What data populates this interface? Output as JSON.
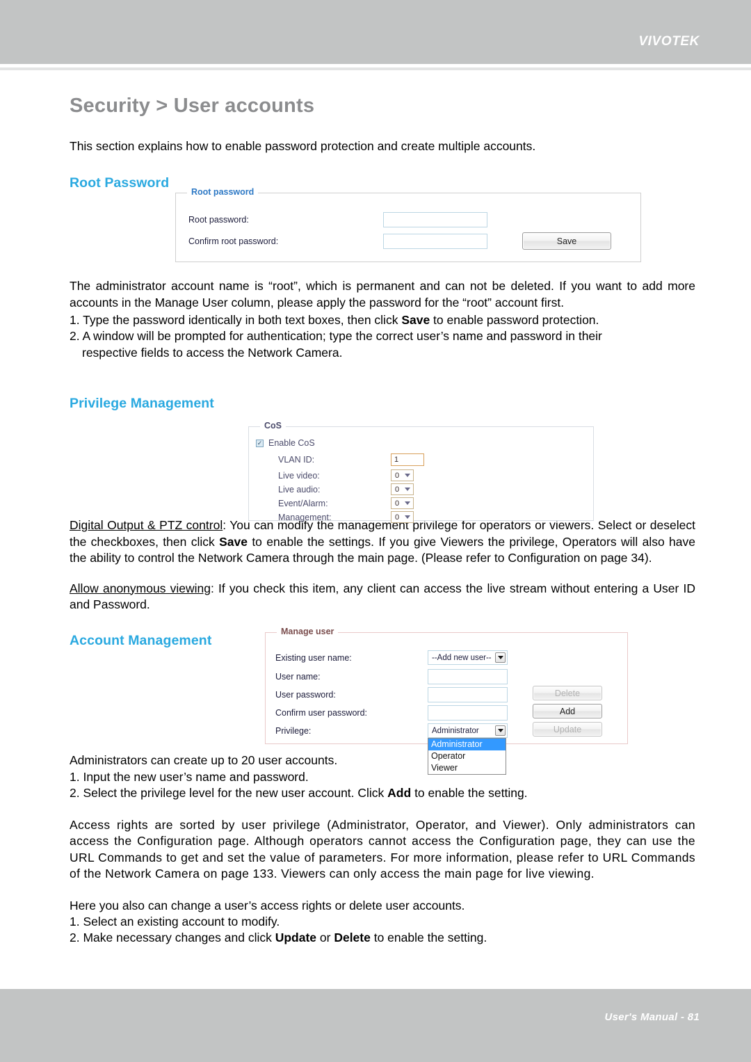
{
  "header": {
    "brand": "VIVOTEK"
  },
  "footer": {
    "page_label": "User's Manual - 81"
  },
  "page": {
    "title": "Security > User accounts",
    "intro": "This section explains how to enable password protection and create multiple accounts."
  },
  "sections": {
    "root_password": {
      "heading": "Root Password",
      "panel": {
        "legend": "Root password",
        "fields": [
          {
            "label": "Root password:",
            "value": ""
          },
          {
            "label": "Confirm root password:",
            "value": ""
          }
        ],
        "save_button": "Save"
      },
      "paragraph": "The administrator account name is “root”, which is permanent and can not be deleted. If you want to add more accounts in the Manage User column, please apply the password for the “root” account first.",
      "step1_a": "1. Type the password identically in both text boxes, then click ",
      "step1_b": "Save",
      "step1_c": " to enable password protection.",
      "step2": "2. A window will be prompted for authentication; type the correct user’s name and password in their",
      "step2_cont": "respective fields to access the Network Camera."
    },
    "privilege_management": {
      "heading": "Privilege Management",
      "panel": {
        "legend": "CoS",
        "enable_label": "Enable CoS",
        "enable_checked": true,
        "rows": [
          {
            "label": "VLAN ID:",
            "value": "1",
            "type": "text"
          },
          {
            "label": "Live video:",
            "value": "0",
            "type": "select"
          },
          {
            "label": "Live audio:",
            "value": "0",
            "type": "select"
          },
          {
            "label": "Event/Alarm:",
            "value": "0",
            "type": "select"
          },
          {
            "label": "Management:",
            "value": "0",
            "type": "select"
          }
        ]
      },
      "digital_output_term": "Digital Output & PTZ control",
      "digital_output_p1": ": You can modify the management privilege for operators or viewers. Select or deselect the checkboxes, then click ",
      "digital_output_bold": "Save",
      "digital_output_p2": " to enable the settings. If you give Viewers the privilege, Operators will also have the ability to control the Network Camera through the main page. (Please refer to Configuration on page 34).",
      "anonymous_term": "Allow anonymous viewing",
      "anonymous_text": ": If you check this item, any client can access the live stream without entering a User ID and Password."
    },
    "account_management": {
      "heading": "Account Management",
      "panel": {
        "legend": "Manage user",
        "rows": [
          {
            "label": "Existing user name:",
            "value": "--Add new user--",
            "type": "select"
          },
          {
            "label": "User name:",
            "value": "",
            "type": "text"
          },
          {
            "label": "User password:",
            "value": "",
            "type": "text"
          },
          {
            "label": "Confirm user password:",
            "value": "",
            "type": "text"
          },
          {
            "label": "Privilege:",
            "value": "Administrator",
            "type": "select"
          }
        ],
        "privilege_options": [
          "Administrator",
          "Operator",
          "Viewer"
        ],
        "privilege_selected": "Administrator",
        "buttons": [
          {
            "label": "Delete",
            "enabled": false
          },
          {
            "label": "Add",
            "enabled": true
          },
          {
            "label": "Update",
            "enabled": false
          }
        ]
      },
      "admins_line": "Administrators can create up to 20 user accounts.",
      "step1": "1. Input the new user’s name and password.",
      "step2_a": "2. Select the privilege level for the new user account. Click ",
      "step2_b": "Add",
      "step2_c": " to enable the setting.",
      "access_rights": "Access rights are sorted by user privilege (Administrator, Operator, and Viewer). Only administrators can access the Configuration page. Although operators cannot access the Configuration page, they can use the URL Commands to get and set the value of parameters. For more information, please refer to URL Commands of the Network Camera on page 133. Viewers can only access the main page for live viewing.",
      "change_line": "Here you also can change a user’s access rights or delete user accounts.",
      "change_step1": "1. Select an existing account to modify.",
      "change_step2_a": "2. Make necessary changes and click ",
      "change_step2_b": "Update",
      "change_step2_mid": " or ",
      "change_step2_c": "Delete",
      "change_step2_d": " to enable the setting."
    }
  },
  "colors": {
    "band": "#c2c4c4",
    "accent_blue": "#2aa9e0",
    "title_gray": "#8b8c8e",
    "legend_blue": "#2e79c5"
  }
}
